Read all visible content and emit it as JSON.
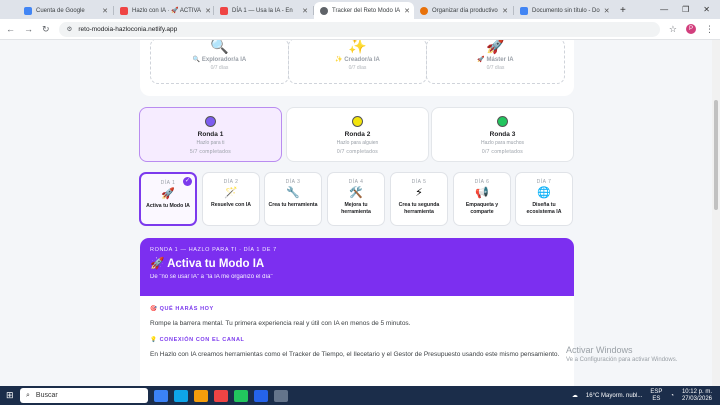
{
  "browser": {
    "tabs": [
      {
        "label": "Cuenta de Google",
        "color": "#4285f4"
      },
      {
        "label": "Hazlo con IA · 🚀 ACTIVA",
        "color": "#ef4444"
      },
      {
        "label": "DÍA 1 — Usa la IA - En",
        "color": "#ef4444"
      },
      {
        "label": "Tracker del Reto Modo IA",
        "color": "#5f6368"
      },
      {
        "label": "Organizar día productivo",
        "color": "#e8710a"
      },
      {
        "label": "Documento sin título - Do",
        "color": "#4285f4"
      }
    ],
    "url": "reto-modoia-hazloconia.netlify.app",
    "avatar": "P"
  },
  "medals": [
    {
      "icon": "🔍",
      "name": "🔍 Explorador/a IA",
      "count": "0/7 días"
    },
    {
      "icon": "✨",
      "name": "✨ Creador/a IA",
      "count": "0/7 días"
    },
    {
      "icon": "🚀",
      "name": "🚀 Máster IA",
      "count": "0/7 días"
    }
  ],
  "rondas": [
    {
      "title": "Ronda 1",
      "sub": "Hazlo para ti",
      "count": "5/7 completados",
      "color": "#7c5cf0"
    },
    {
      "title": "Ronda 2",
      "sub": "Hazlo para alguien",
      "count": "0/7 completados",
      "color": "#f2e40c"
    },
    {
      "title": "Ronda 3",
      "sub": "Hazlo para muchos",
      "count": "0/7 completados",
      "color": "#22c55e"
    }
  ],
  "days": [
    {
      "n": "DÍA 1",
      "icon": "🚀",
      "t": "Activa tu Modo IA"
    },
    {
      "n": "DÍA 2",
      "icon": "🪄",
      "t": "Resuelve con IA"
    },
    {
      "n": "DÍA 3",
      "icon": "🔧",
      "t": "Crea tu herramienta"
    },
    {
      "n": "DÍA 4",
      "icon": "🛠️",
      "t": "Mejora tu herramienta"
    },
    {
      "n": "DÍA 5",
      "icon": "⚡",
      "t": "Crea tu segunda herramienta"
    },
    {
      "n": "DÍA 6",
      "icon": "📢",
      "t": "Empaqueta y comparte"
    },
    {
      "n": "DÍA 7",
      "icon": "🌐",
      "t": "Diseña tu ecosistema IA"
    }
  ],
  "checkmark": "✓",
  "hero": {
    "kicker": "RONDA 1 — HAZLO PARA TI · DÍA 1 DE 7",
    "title": "🚀 Activa tu Modo IA",
    "subtitle": "De \"no sé usar IA\" a \"la IA me organizó el día\""
  },
  "sections": [
    {
      "heading": "🎯 QUÉ HARÁS HOY",
      "text": "Rompe la barrera mental. Tu primera experiencia real y útil con IA en menos de 5 minutos."
    },
    {
      "heading": "💡 CONEXIÓN CON EL CANAL",
      "text": "En Hazlo con IA creamos herramientas como el Tracker de Tiempo, el Ilecetario y el Gestor de Presupuesto usando este mismo pensamiento."
    }
  ],
  "watermark": {
    "title": "Activar Windows",
    "sub": "Ve a Configuración para activar Windows."
  },
  "taskbar": {
    "search": "Buscar",
    "weather": "16°C  Mayorm. nubl...",
    "lang": "ESP",
    "region": "ES",
    "time": "10:12 p. m.",
    "date": "27/03/2026"
  }
}
